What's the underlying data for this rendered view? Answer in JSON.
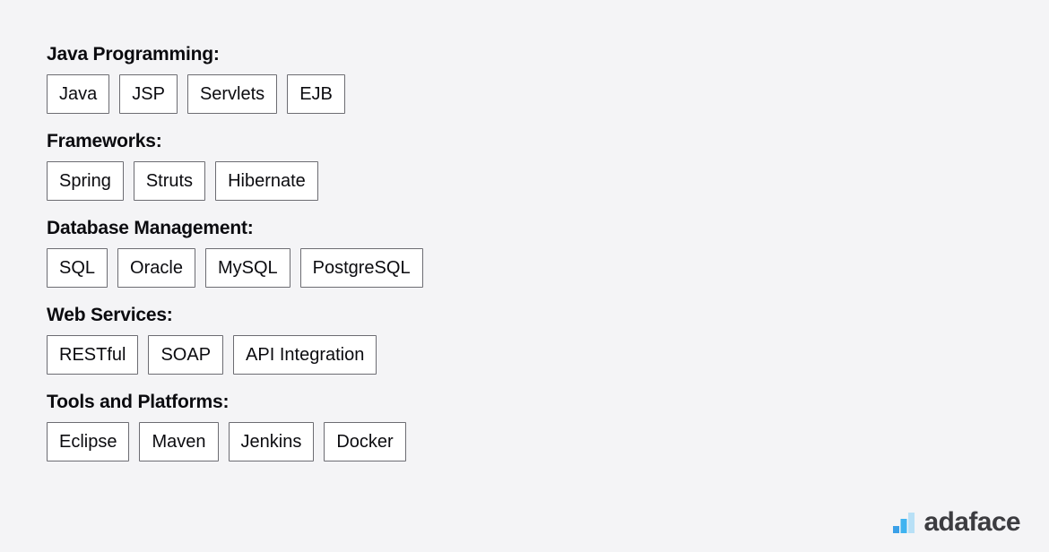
{
  "page": {
    "background_color": "#f4f4f6",
    "text_color": "#0b0b0f",
    "chip_border_color": "#6c6c72",
    "chip_fill_color": "#ffffff"
  },
  "skill_groups": [
    {
      "heading": "Java Programming:",
      "chips": [
        "Java",
        "JSP",
        "Servlets",
        "EJB"
      ]
    },
    {
      "heading": "Frameworks:",
      "chips": [
        "Spring",
        "Struts",
        "Hibernate"
      ]
    },
    {
      "heading": "Database Management:",
      "chips": [
        "SQL",
        "Oracle",
        "MySQL",
        "PostgreSQL"
      ]
    },
    {
      "heading": "Web Services:",
      "chips": [
        "RESTful",
        "SOAP",
        "API Integration"
      ]
    },
    {
      "heading": "Tools and Platforms:",
      "chips": [
        "Eclipse",
        "Maven",
        "Jenkins",
        "Docker"
      ]
    }
  ],
  "brand": {
    "name": "adaface",
    "icon": "bar-chart-logo-icon",
    "text_color": "#3c3c40",
    "bar_colors": [
      "#3aa0e8",
      "#3fb3f0",
      "#b8e0f6"
    ]
  }
}
